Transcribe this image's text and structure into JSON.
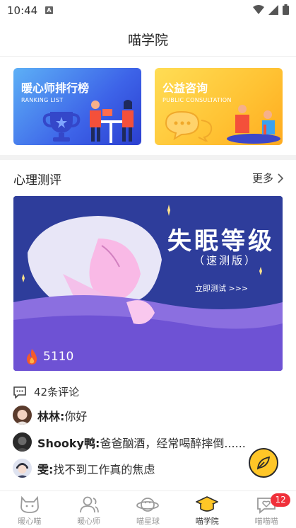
{
  "status_bar": {
    "time": "10:44",
    "notification_letter": "A"
  },
  "header": {
    "title": "喵学院"
  },
  "cards": [
    {
      "title": "暖心师排行榜",
      "subtitle": "RANKING LIST"
    },
    {
      "title": "公益咨询",
      "subtitle": "PUBLIC CONSULTATION"
    }
  ],
  "section": {
    "title": "心理测评",
    "more_label": "更多"
  },
  "banner": {
    "title": "失眠等级",
    "subtitle": "（速测版）",
    "cta": "立即测试 >>>",
    "count": "5110"
  },
  "comments": {
    "count_label": "42条评论",
    "items": [
      {
        "user": "林林:",
        "text": " 你好"
      },
      {
        "user": "Shooky鸭:",
        "text": " 爸爸酗酒，经常喝醉摔倒......"
      },
      {
        "user": "雯:",
        "text": " 找不到工作真的焦虑"
      }
    ]
  },
  "tabs": [
    {
      "label": "暖心喵",
      "icon": "cat-icon"
    },
    {
      "label": "暖心师",
      "icon": "people-icon"
    },
    {
      "label": "喵星球",
      "icon": "planet-icon"
    },
    {
      "label": "喵学院",
      "icon": "graduation-cap-icon",
      "active": true
    },
    {
      "label": "喵喵喵",
      "icon": "chat-heart-icon",
      "badge": "12"
    }
  ],
  "colors": {
    "accent": "#ffc627",
    "badge": "#f0303a",
    "banner_bg": "#2e3d9b"
  }
}
